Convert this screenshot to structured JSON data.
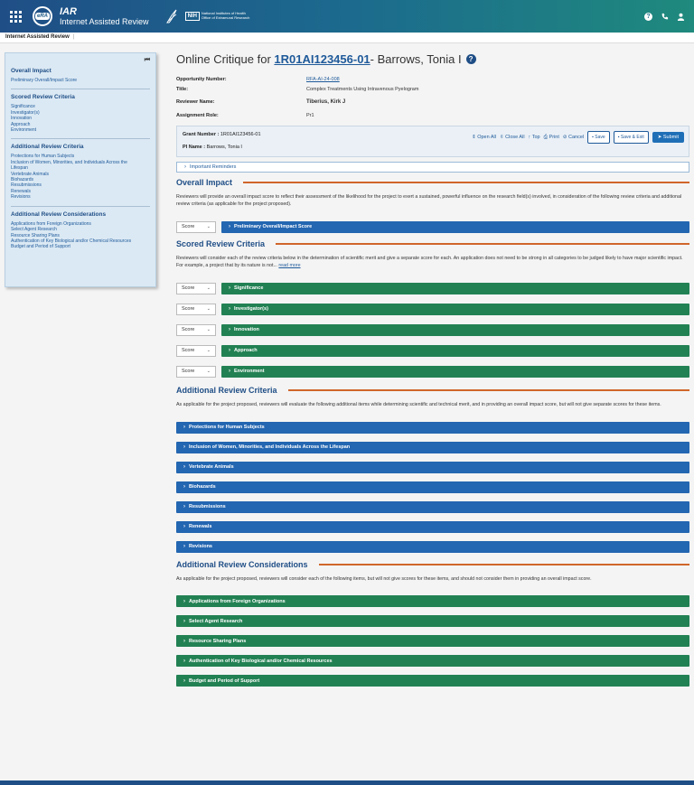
{
  "header": {
    "app_abbr": "IAR",
    "app_name": "Internet Assisted Review",
    "era_logo": "eRA",
    "nih_box": "NIH",
    "nih_name": "National Institutes of Health",
    "nih_sub": "Office of Extramural Research"
  },
  "subbar": {
    "title": "Internet Assisted Review",
    "separator": "|"
  },
  "sidebar": {
    "sections": [
      {
        "title": "Overall Impact",
        "items": [
          "Preliminary Overall/Impact Score"
        ]
      },
      {
        "title": "Scored Review Criteria",
        "items": [
          "Significance",
          "Investigator(s)",
          "Innovation",
          "Approach",
          "Environment"
        ]
      },
      {
        "title": "Additional Review Criteria",
        "items": [
          "Protections for Human Subjects",
          "Inclusion of Women, Minorities, and Individuals Across the",
          "Lifespan",
          "Vertebrate Animals",
          "Biohazards",
          "Resubmissions",
          "Renewals",
          "Revisions"
        ]
      },
      {
        "title": "Additional Review Considerations",
        "items": [
          "Applications from Foreign Organizations",
          "Select Agent Research",
          "Resource Sharing Plans",
          "Authentication of Key Biological and/or Chemical Resources",
          "Budget and Period of Support"
        ]
      }
    ]
  },
  "page": {
    "heading_prefix": "Online Critique for ",
    "grant_link": "1R01AI123456-01",
    "heading_suffix": " - Barrows, Tonia I",
    "help_glyph": "?"
  },
  "info": {
    "opportunity_label": "Opportunity Number:",
    "opportunity_value": "RFA-AI-24-008",
    "title_label": "Title:",
    "title_value": "Complex Treatments Using Intravenous Pyelogram",
    "reviewer_label": "Reviewer Name:",
    "reviewer_value": "Tiberius, Kirk J",
    "role_label": "Assignment Role:",
    "role_value": "Pr1"
  },
  "grant_box": {
    "grant_label": "Grant Number :",
    "grant_value": "1R01AI123456-01",
    "pi_label": "PI Name :",
    "pi_value": "Barrows, Tonia I",
    "open_all": "Open All",
    "close_all": "Close All",
    "top": "Top",
    "print": "Print",
    "cancel": "Cancel",
    "save": "Save",
    "save_exit": "Save & Exit",
    "submit": "Submit"
  },
  "reminders": "Important Reminders",
  "overall": {
    "title": "Overall Impact",
    "desc": "Reviewers will provide an overall impact score to reflect their assessment of the likelihood for the project to exert a sustained, powerful influence on the research field(s) involved, in consideration of the following review criteria and additional review criteria (as applicable for the project proposed).",
    "score_label": "Score",
    "bar_label": "Preliminary Overall/Impact Score"
  },
  "scored": {
    "title": "Scored Review Criteria",
    "desc": "Reviewers will consider each of the review criteria below in the determination of scientific merit and give a separate score for each. An application does not need to be strong in all categories to be judged likely to have major scientific impact. For example, a project that by its nature is not...",
    "read_more": "read more",
    "score_label": "Score",
    "items": [
      "Significance",
      "Investigator(s)",
      "Innovation",
      "Approach",
      "Environment"
    ]
  },
  "additional_criteria": {
    "title": "Additional Review Criteria",
    "desc": "As applicable for the project proposed, reviewers will evaluate the following additional items while determining scientific and technical merit, and in providing an overall impact score, but will not give separate scores for these items.",
    "items": [
      "Protections for Human Subjects",
      "Inclusion of Women, Minorities, and Individuals Across the Lifespan",
      "Vertebrate Animals",
      "Biohazards",
      "Resubmissions",
      "Renewals",
      "Revisions"
    ]
  },
  "considerations": {
    "title": "Additional Review Considerations",
    "desc": "As applicable for the project proposed, reviewers will consider each of the following items, but will not give scores for these items, and should not consider them in providing an overall impact score.",
    "items": [
      "Applications from Foreign Organizations",
      "Select Agent Research",
      "Resource Sharing Plans",
      "Authentication of Key Biological and/or Chemical Resources",
      "Budget and Period of Support"
    ]
  },
  "colors": {
    "blue_bar": "#2366b1",
    "green_bar": "#228153",
    "accent_rule": "#d0662a"
  }
}
